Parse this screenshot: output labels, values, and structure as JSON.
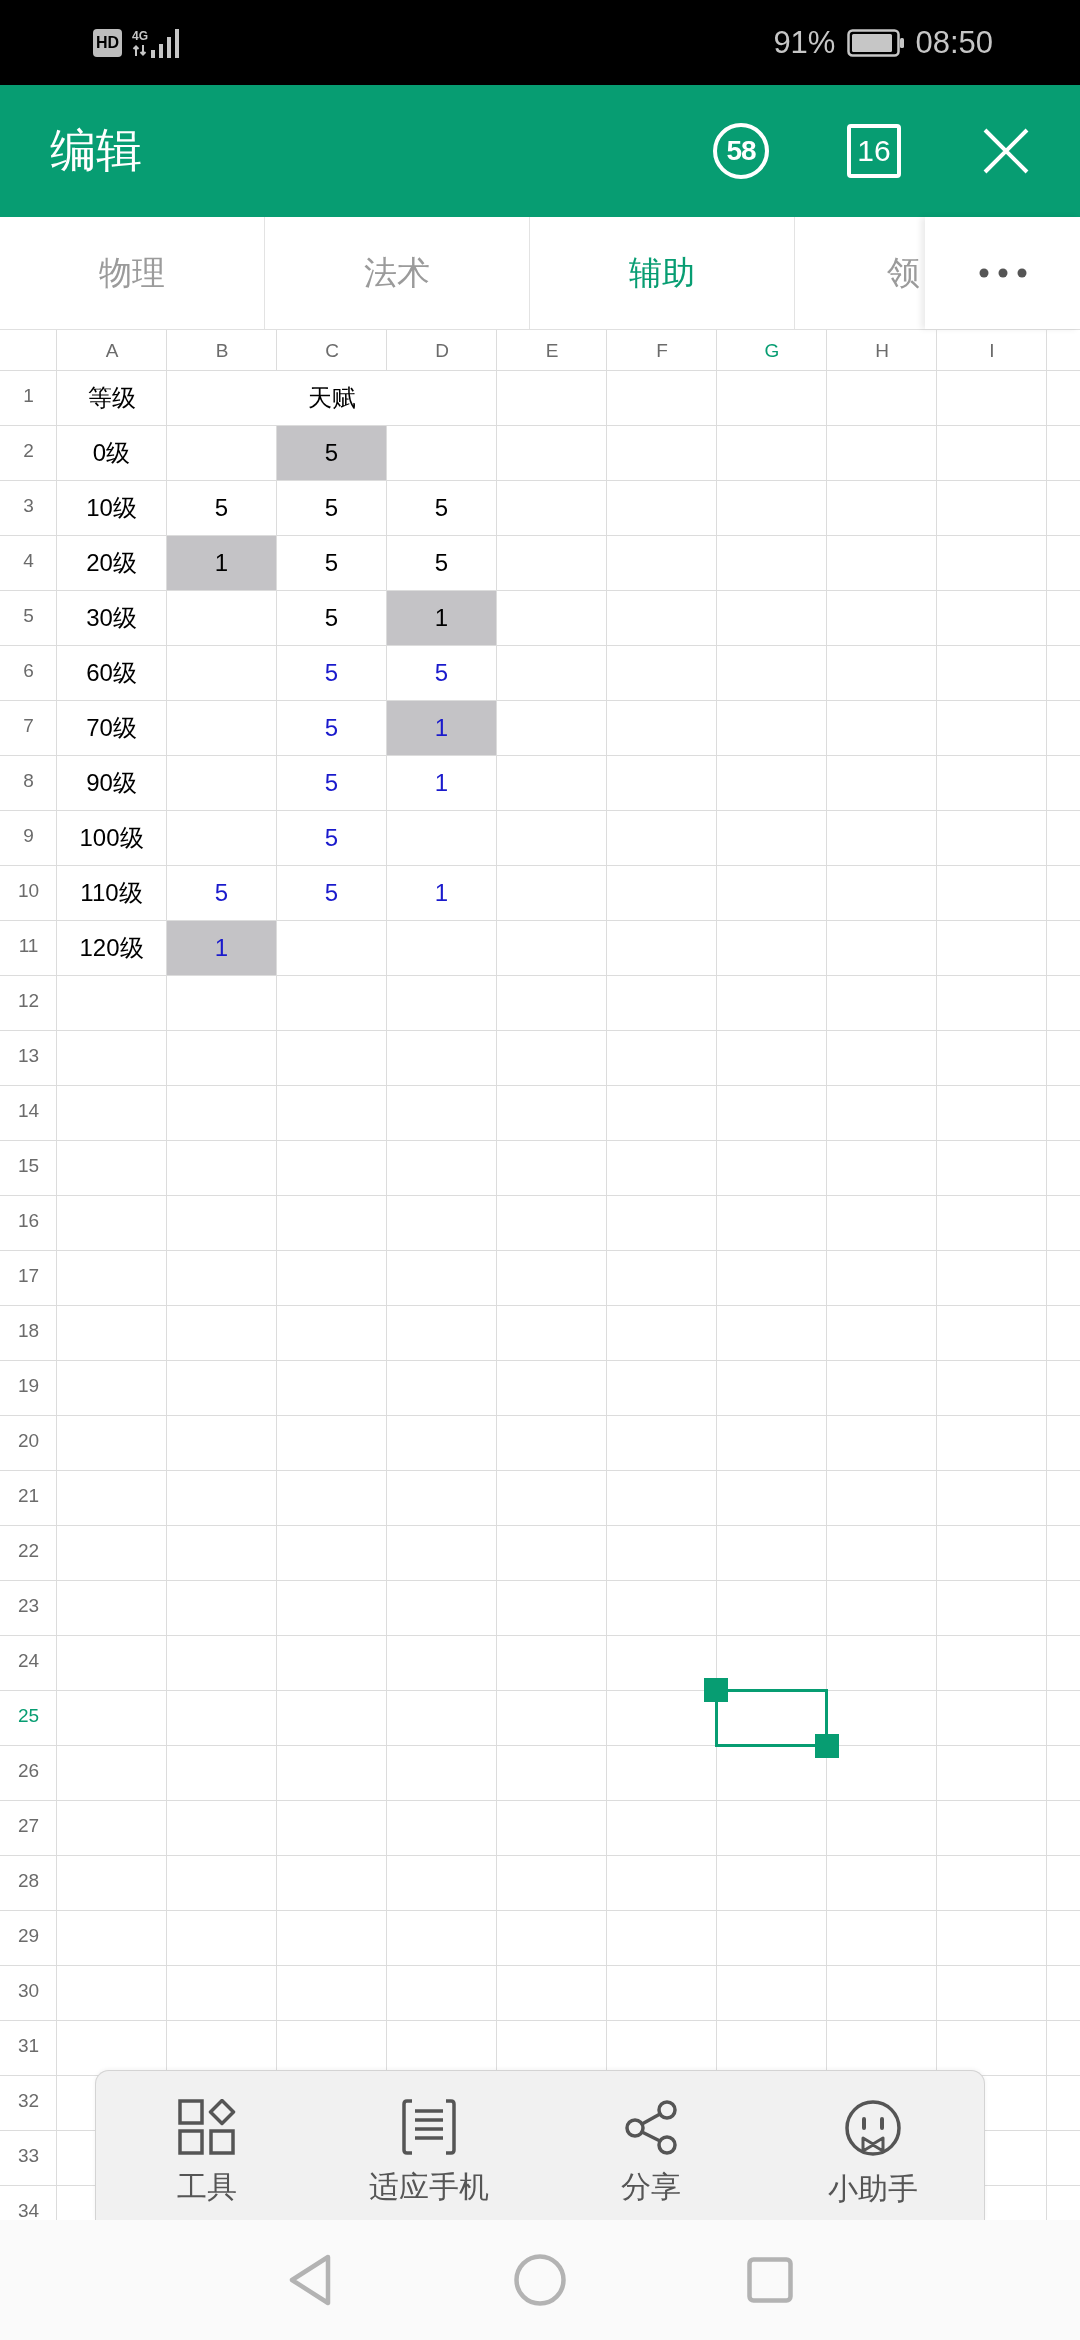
{
  "status_bar": {
    "hd": "HD",
    "network": "4G",
    "battery": "91%",
    "time": "08:50"
  },
  "header": {
    "title": "编辑",
    "circled_number": "58",
    "boxed_number": "16"
  },
  "sheet_tabs": [
    {
      "label": "物理",
      "selected": false
    },
    {
      "label": "法术",
      "selected": false
    },
    {
      "label": "辅助",
      "selected": true
    },
    {
      "label": "领",
      "selected": false
    }
  ],
  "sheet": {
    "columns": [
      {
        "label": "A",
        "selected": false
      },
      {
        "label": "B",
        "selected": false
      },
      {
        "label": "C",
        "selected": false
      },
      {
        "label": "D",
        "selected": false
      },
      {
        "label": "E",
        "selected": false
      },
      {
        "label": "F",
        "selected": false
      },
      {
        "label": "G",
        "selected": true
      },
      {
        "label": "H",
        "selected": false
      },
      {
        "label": "I",
        "selected": false
      }
    ],
    "rows": [
      {
        "number": "1",
        "selected": false,
        "cells": [
          {
            "kind": "single",
            "text": "等级",
            "color": "#000000",
            "shaded": false
          },
          {
            "kind": "single",
            "text": "天赋",
            "color": "#000000",
            "shaded": false
          },
          {
            "kind": "merged"
          },
          {
            "kind": "merged"
          }
        ]
      },
      {
        "number": "2",
        "selected": false,
        "cells": [
          {
            "text": "0级",
            "color": "#000000",
            "shaded": false
          },
          {
            "shaded": false
          },
          {
            "text": "5",
            "color": "#000000",
            "shaded": true
          },
          {
            "shaded": false
          }
        ]
      },
      {
        "number": "3",
        "selected": false,
        "cells": [
          {
            "text": "10级",
            "color": "#000000",
            "shaded": false
          },
          {
            "text": "5",
            "color": "#000000",
            "shaded": false
          },
          {
            "text": "5",
            "color": "#000000",
            "shaded": false
          },
          {
            "text": "5",
            "color": "#000000",
            "shaded": false
          }
        ]
      },
      {
        "number": "4",
        "selected": false,
        "cells": [
          {
            "text": "20级",
            "color": "#000000",
            "shaded": false
          },
          {
            "text": "1",
            "color": "#000000",
            "shaded": true
          },
          {
            "text": "5",
            "color": "#000000",
            "shaded": false
          },
          {
            "text": "5",
            "color": "#000000",
            "shaded": false
          }
        ]
      },
      {
        "number": "5",
        "selected": false,
        "cells": [
          {
            "text": "30级",
            "color": "#000000",
            "shaded": false
          },
          {
            "shaded": false
          },
          {
            "text": "5",
            "color": "#000000",
            "shaded": false
          },
          {
            "text": "1",
            "color": "#000000",
            "shaded": true
          }
        ]
      },
      {
        "number": "6",
        "selected": false,
        "cells": [
          {
            "text": "60级",
            "color": "#000000",
            "shaded": false
          },
          {
            "shaded": false
          },
          {
            "text": "5",
            "color": "#1a1acc",
            "shaded": false
          },
          {
            "text": "5",
            "color": "#1a1acc",
            "shaded": false
          }
        ]
      },
      {
        "number": "7",
        "selected": false,
        "cells": [
          {
            "text": "70级",
            "color": "#000000",
            "shaded": false
          },
          {
            "shaded": false
          },
          {
            "text": "5",
            "color": "#1a1acc",
            "shaded": false
          },
          {
            "text": "1",
            "color": "#1a1acc",
            "shaded": true
          }
        ]
      },
      {
        "number": "8",
        "selected": false,
        "cells": [
          {
            "text": "90级",
            "color": "#000000",
            "shaded": false
          },
          {
            "shaded": false
          },
          {
            "text": "5",
            "color": "#1a1acc",
            "shaded": false
          },
          {
            "text": "1",
            "color": "#1a1acc",
            "shaded": false
          }
        ]
      },
      {
        "number": "9",
        "selected": false,
        "cells": [
          {
            "text": "100级",
            "color": "#000000",
            "shaded": false
          },
          {
            "shaded": false
          },
          {
            "text": "5",
            "color": "#1a1acc",
            "shaded": false
          },
          {
            "shaded": false
          }
        ]
      },
      {
        "number": "10",
        "selected": false,
        "cells": [
          {
            "text": "110级",
            "color": "#000000",
            "shaded": false
          },
          {
            "text": "5",
            "color": "#1a1acc",
            "shaded": false
          },
          {
            "text": "5",
            "color": "#1a1acc",
            "shaded": false
          },
          {
            "text": "1",
            "color": "#1a1acc",
            "shaded": false
          }
        ]
      },
      {
        "number": "11",
        "selected": false,
        "cells": [
          {
            "text": "120级",
            "color": "#000000",
            "shaded": false
          },
          {
            "text": "1",
            "color": "#1a1acc",
            "shaded": true
          },
          {
            "shaded": false
          },
          {
            "shaded": false
          }
        ]
      },
      {
        "number": "12",
        "selected": false
      },
      {
        "number": "13",
        "selected": false
      },
      {
        "number": "14",
        "selected": false
      },
      {
        "number": "15",
        "selected": false
      },
      {
        "number": "16",
        "selected": false
      },
      {
        "number": "17",
        "selected": false
      },
      {
        "number": "18",
        "selected": false
      },
      {
        "number": "19",
        "selected": false
      },
      {
        "number": "20",
        "selected": false
      },
      {
        "number": "21",
        "selected": false
      },
      {
        "number": "22",
        "selected": false
      },
      {
        "number": "23",
        "selected": false
      },
      {
        "number": "24",
        "selected": false
      },
      {
        "number": "25",
        "selected": true
      },
      {
        "number": "26",
        "selected": false
      },
      {
        "number": "27",
        "selected": false
      },
      {
        "number": "28",
        "selected": false
      },
      {
        "number": "29",
        "selected": false
      },
      {
        "number": "30",
        "selected": false
      },
      {
        "number": "31",
        "selected": false
      },
      {
        "number": "32",
        "selected": false
      },
      {
        "number": "33",
        "selected": false
      },
      {
        "number": "34",
        "selected": false
      }
    ]
  },
  "toolbar": [
    {
      "kind": "tools",
      "label": "工具"
    },
    {
      "kind": "fit",
      "label": "适应手机"
    },
    {
      "kind": "share",
      "label": "分享"
    },
    {
      "kind": "helper",
      "label": "小助手"
    }
  ]
}
